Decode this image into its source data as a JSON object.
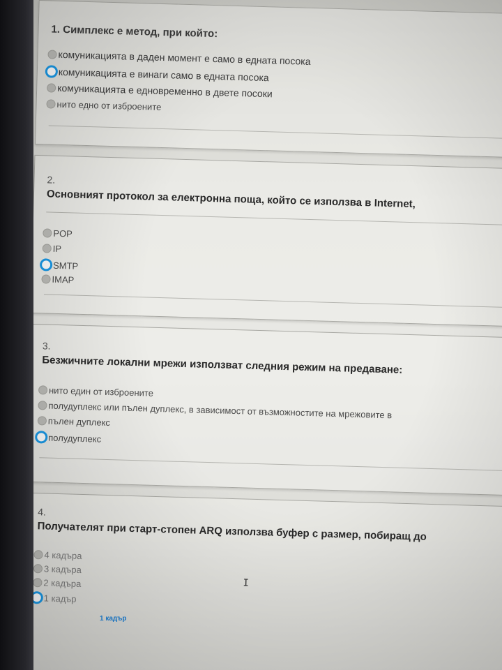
{
  "questions": [
    {
      "number": "1.",
      "text": "Симплекс е метод, при който:",
      "options": [
        "комуникацията в даден момент е само в едната посока",
        "комуникацията е винаги само в едната посока",
        "комуникацията е едновременно в двете посоки",
        "нито едно от изброените"
      ],
      "selected_index": 1
    },
    {
      "number": "2.",
      "text": "Основният протокол за електронна поща, който се използва в Internet,",
      "options": [
        "POP",
        "IP",
        "SMTP",
        "IMAP"
      ],
      "selected_index": 2
    },
    {
      "number": "3.",
      "text": "Безжичните локални мрежи използват следния режим на предаване:",
      "options": [
        "нито един от изброените",
        "полудуплекс или пълен дуплекс, в зависимост от възможностите на мрежовите в",
        "пълен дуплекс",
        "полудуплекс"
      ],
      "selected_index": 3
    },
    {
      "number": "4.",
      "text": "Получателят при старт-стопен ARQ използва буфер с размер, побиращ до",
      "options": [
        "4 кадъра",
        "3 кадъра",
        "2 кадъра",
        "1 кадър"
      ],
      "selected_index": 3
    }
  ],
  "annotation_label": "1 кадър",
  "accent_color": "#1a9ae8"
}
